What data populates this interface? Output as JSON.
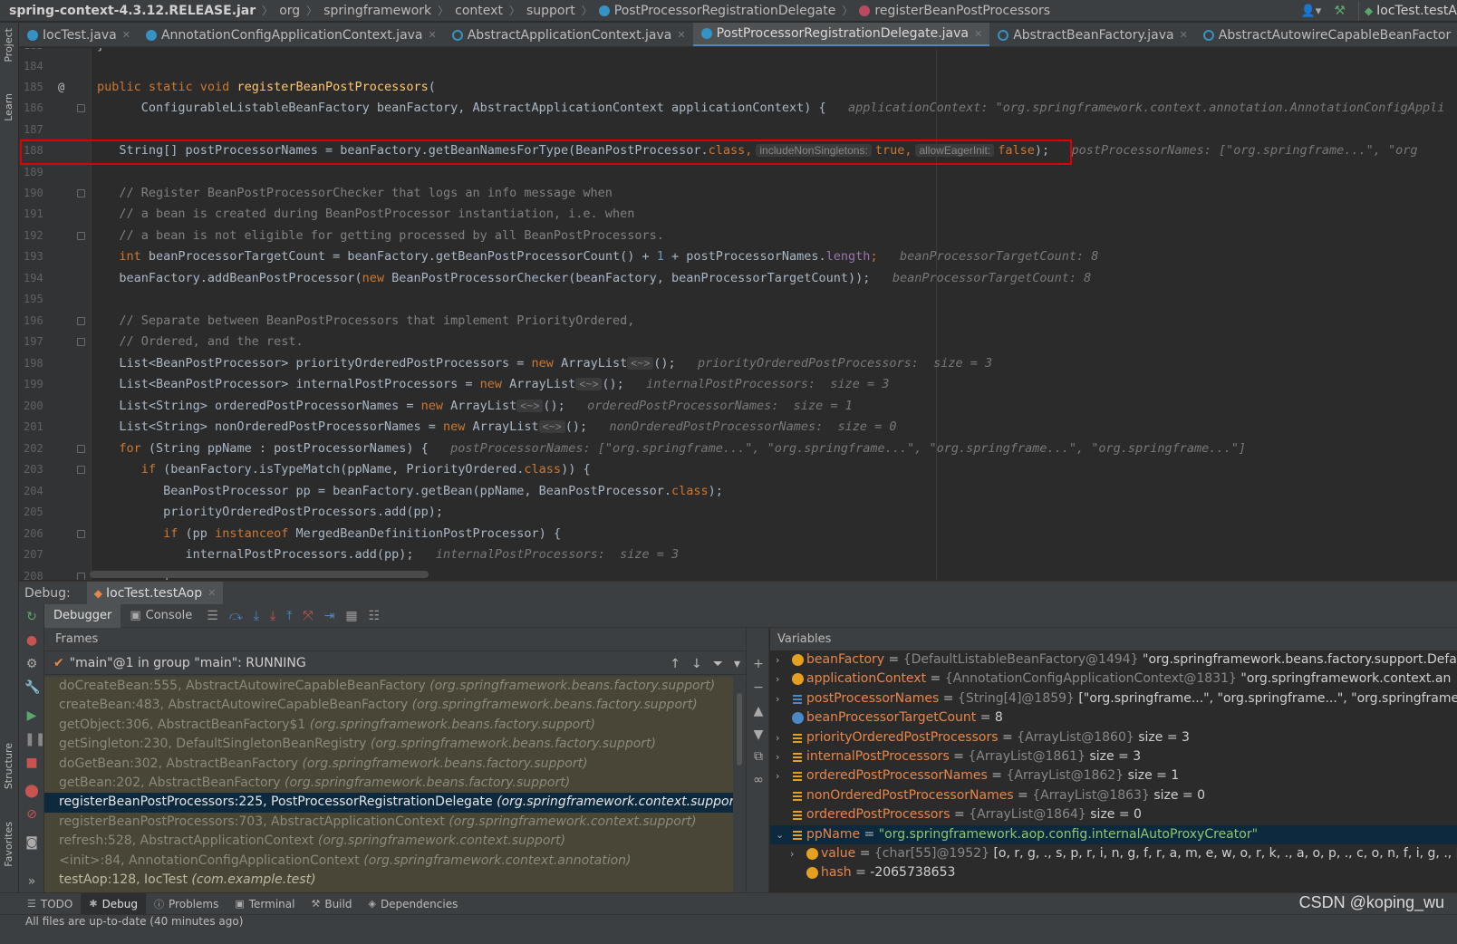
{
  "navbar": {
    "crumbs": [
      "spring-context-4.3.12.RELEASE.jar",
      "org",
      "springframework",
      "context",
      "support",
      "PostProcessorRegistrationDelegate",
      "registerBeanPostProcessors"
    ],
    "run_config": "IocTest.testA"
  },
  "left_strip": {
    "project": "Project",
    "learn": "Learn",
    "structure": "Structure",
    "favorites": "Favorites"
  },
  "tabs": [
    {
      "label": "IocTest.java",
      "icon": "class-icon",
      "active": false
    },
    {
      "label": "AnnotationConfigApplicationContext.java",
      "icon": "class-icon",
      "active": false
    },
    {
      "label": "AbstractApplicationContext.java",
      "icon": "abstract-class-icon",
      "active": false
    },
    {
      "label": "PostProcessorRegistrationDelegate.java",
      "icon": "class-icon",
      "active": true
    },
    {
      "label": "AbstractBeanFactory.java",
      "icon": "abstract-class-icon",
      "active": false
    },
    {
      "label": "AbstractAutowireCapableBeanFactor",
      "icon": "abstract-class-icon",
      "active": false
    }
  ],
  "editor": {
    "line_numbers": [
      "184",
      "185",
      "186",
      "187",
      "188",
      "189",
      "190",
      "191",
      "192",
      "193",
      "194",
      "195",
      "196",
      "197",
      "198",
      "199",
      "200",
      "201",
      "202",
      "203",
      "204",
      "205",
      "206",
      "207",
      "208"
    ],
    "top_partial_number": "183",
    "top_partial_code": "}",
    "gutter_marker": "@",
    "code": {
      "l185": {
        "kw": "public static void ",
        "fn": "registerBeanPostProcessors",
        "rest": "("
      },
      "l186": {
        "code": "      ConfigurableListableBeanFactory beanFactory, AbstractApplicationContext applicationContext) {",
        "inline": "applicationContext: \"org.springframework.context.annotation.AnnotationConfigAppli"
      },
      "l188": {
        "a": "   String[] postProcessorNames = beanFactory.getBeanNamesForType(BeanPostProcessor.",
        "kw_class": "class",
        "comma": ",",
        "hint1": "includeNonSingletons:",
        "kw_true": "true",
        "comma2": ",",
        "hint2": "allowEagerInit:",
        "kw_false": "false",
        "end": ");",
        "inline": "postProcessorNames: [\"org.springframe...\", \"org"
      },
      "l190": "   // Register BeanPostProcessorChecker that logs an info message when",
      "l191": "   // a bean is created during BeanPostProcessor instantiation, i.e. when",
      "l192": "   // a bean is not eligible for getting processed by all BeanPostProcessors.",
      "l193": {
        "kw": "   int ",
        "a": "beanProcessorTargetCount = beanFactory.getBeanPostProcessorCount() + ",
        "num": "1",
        "b": " + postProcessorNames.",
        "fld": "length",
        "c": ";",
        "inline": "beanProcessorTargetCount: 8"
      },
      "l194": {
        "a": "   beanFactory.addBeanPostProcessor(",
        "kw": "new",
        "b": " BeanPostProcessorChecker(beanFactory, beanProcessorTargetCount));",
        "inline": "beanProcessorTargetCount: 8"
      },
      "l196": "   // Separate between BeanPostProcessors that implement PriorityOrdered,",
      "l197": "   // Ordered, and the rest.",
      "l198": {
        "a": "   List<BeanPostProcessor> priorityOrderedPostProcessors = ",
        "kw": "new",
        "b": " ArrayList",
        "d": "<~>",
        "c": "();",
        "inline": "priorityOrderedPostProcessors:  size = 3"
      },
      "l199": {
        "a": "   List<BeanPostProcessor> internalPostProcessors = ",
        "kw": "new",
        "b": " ArrayList",
        "d": "<~>",
        "c": "();",
        "inline": "internalPostProcessors:  size = 3"
      },
      "l200": {
        "a": "   List<String> orderedPostProcessorNames = ",
        "kw": "new",
        "b": " ArrayList",
        "d": "<~>",
        "c": "();",
        "inline": "orderedPostProcessorNames:  size = 1"
      },
      "l201": {
        "a": "   List<String> nonOrderedPostProcessorNames = ",
        "kw": "new",
        "b": " ArrayList",
        "d": "<~>",
        "c": "();",
        "inline": "nonOrderedPostProcessorNames:  size = 0"
      },
      "l202": {
        "kw": "   for ",
        "a": "(String ppName : postProcessorNames) {",
        "inline": "postProcessorNames: [\"org.springframe...\", \"org.springframe...\", \"org.springframe...\", \"org.springframe...\"]"
      },
      "l203": {
        "kw": "      if ",
        "a": "(beanFactory.isTypeMatch(ppName, PriorityOrdered.",
        "kw2": "class",
        "b": ")) {"
      },
      "l204": {
        "a": "         BeanPostProcessor pp = beanFactory.getBean(ppName, BeanPostProcessor.",
        "kw": "class",
        "b": ");"
      },
      "l205": "         priorityOrderedPostProcessors.add(pp);",
      "l206": {
        "kw": "         if ",
        "a": "(pp ",
        "kw2": "instanceof",
        "b": " MergedBeanDefinitionPostProcessor) {"
      },
      "l207": {
        "a": "            internalPostProcessors.add(pp);",
        "inline": "internalPostProcessors:  size = 3"
      },
      "l208": "         }"
    }
  },
  "debug": {
    "label": "Debug:",
    "session": "IocTest.testAop",
    "tabs": {
      "debugger": "Debugger",
      "console": "Console"
    },
    "frames_title": "Frames",
    "thread": "\"main\"@1 in group \"main\": RUNNING",
    "frames": [
      {
        "method": "doCreateBean:555, AbstractAutowireCapableBeanFactory ",
        "pkg": "(org.springframework.beans.factory.support)",
        "state": "dim"
      },
      {
        "method": "createBean:483, AbstractAutowireCapableBeanFactory ",
        "pkg": "(org.springframework.beans.factory.support)",
        "state": "dim"
      },
      {
        "method": "getObject:306, AbstractBeanFactory$1 ",
        "pkg": "(org.springframework.beans.factory.support)",
        "state": "dim"
      },
      {
        "method": "getSingleton:230, DefaultSingletonBeanRegistry ",
        "pkg": "(org.springframework.beans.factory.support)",
        "state": "dim"
      },
      {
        "method": "doGetBean:302, AbstractBeanFactory ",
        "pkg": "(org.springframework.beans.factory.support)",
        "state": "dim"
      },
      {
        "method": "getBean:202, AbstractBeanFactory ",
        "pkg": "(org.springframework.beans.factory.support)",
        "state": "dim"
      },
      {
        "method": "registerBeanPostProcessors:225, PostProcessorRegistrationDelegate ",
        "pkg": "(org.springframework.context.support)",
        "state": "sel"
      },
      {
        "method": "registerBeanPostProcessors:703, AbstractApplicationContext ",
        "pkg": "(org.springframework.context.support)",
        "state": "dim"
      },
      {
        "method": "refresh:528, AbstractApplicationContext ",
        "pkg": "(org.springframework.context.support)",
        "state": "dim"
      },
      {
        "method": "<init>:84, AnnotationConfigApplicationContext ",
        "pkg": "(org.springframework.context.annotation)",
        "state": "dim"
      },
      {
        "method": "testAop:128, IocTest ",
        "pkg": "(com.example.test)",
        "state": "light"
      }
    ],
    "variables_title": "Variables",
    "variables": [
      {
        "name": "beanFactory",
        "eq": " = ",
        "type": "{DefaultListableBeanFactory@1494} ",
        "value": "\"org.springframework.beans.factory.support.Defa",
        "icon": "param-icon",
        "expand": "›",
        "str": false
      },
      {
        "name": "applicationContext",
        "eq": " = ",
        "type": "{AnnotationConfigApplicationContext@1831} ",
        "value": "\"org.springframework.context.an",
        "icon": "param-icon",
        "expand": "›",
        "str": false
      },
      {
        "name": "postProcessorNames",
        "eq": " = ",
        "type": "{String[4]@1859} ",
        "value": "[\"org.springframe...\", \"org.springframe...\", \"org.springframe...\"",
        "icon": "array-icon",
        "expand": "›",
        "str": false
      },
      {
        "name": "beanProcessorTargetCount",
        "eq": " = ",
        "type": "",
        "value": "8",
        "icon": "int-icon",
        "expand": "",
        "str": false
      },
      {
        "name": "priorityOrderedPostProcessors",
        "eq": " = ",
        "type": "{ArrayList@1860} ",
        "value": " size = 3",
        "icon": "list-icon",
        "expand": "›",
        "str": false
      },
      {
        "name": "internalPostProcessors",
        "eq": " = ",
        "type": "{ArrayList@1861} ",
        "value": " size = 3",
        "icon": "list-icon",
        "expand": "›",
        "str": false
      },
      {
        "name": "orderedPostProcessorNames",
        "eq": " = ",
        "type": "{ArrayList@1862} ",
        "value": " size = 1",
        "icon": "list-icon",
        "expand": "›",
        "str": false
      },
      {
        "name": "nonOrderedPostProcessorNames",
        "eq": " = ",
        "type": "{ArrayList@1863} ",
        "value": " size = 0",
        "icon": "list-icon",
        "expand": "",
        "str": false
      },
      {
        "name": "orderedPostProcessors",
        "eq": " = ",
        "type": "{ArrayList@1864} ",
        "value": " size = 0",
        "icon": "list-icon",
        "expand": "",
        "str": false
      },
      {
        "name": "ppName",
        "eq": " = ",
        "type": "",
        "value": "\"org.springframework.aop.config.internalAutoProxyCreator\"",
        "icon": "list-icon",
        "expand": "⌄",
        "str": true,
        "selected": true
      },
      {
        "name": "value",
        "eq": " = ",
        "type": "{char[55]@1952} ",
        "value": "[o, r, g, ., s, p, r, i, n, g, f, r, a, m, e, w, o, r, k, ., a, o, p, ., c, o, n, f, i, g, ., i, n, t, e, r",
        "icon": "field-icon",
        "expand": "›",
        "str": false,
        "child": true
      },
      {
        "name": "hash",
        "eq": " = ",
        "type": "",
        "value": "-2065738653",
        "icon": "field-icon",
        "expand": "",
        "str": false,
        "child": true
      }
    ]
  },
  "bottom_bar": {
    "tabs": [
      {
        "label": "TODO",
        "icon": "list-icon",
        "active": false
      },
      {
        "label": "Debug",
        "icon": "bug-icon",
        "active": true
      },
      {
        "label": "Problems",
        "icon": "info-icon",
        "active": false
      },
      {
        "label": "Terminal",
        "icon": "terminal-icon",
        "active": false
      },
      {
        "label": "Build",
        "icon": "hammer-icon",
        "active": false
      },
      {
        "label": "Dependencies",
        "icon": "stack-icon",
        "active": false
      }
    ],
    "watermark": "CSDN @koping_wu",
    "status": "All files are up-to-date (40 minutes ago)"
  }
}
